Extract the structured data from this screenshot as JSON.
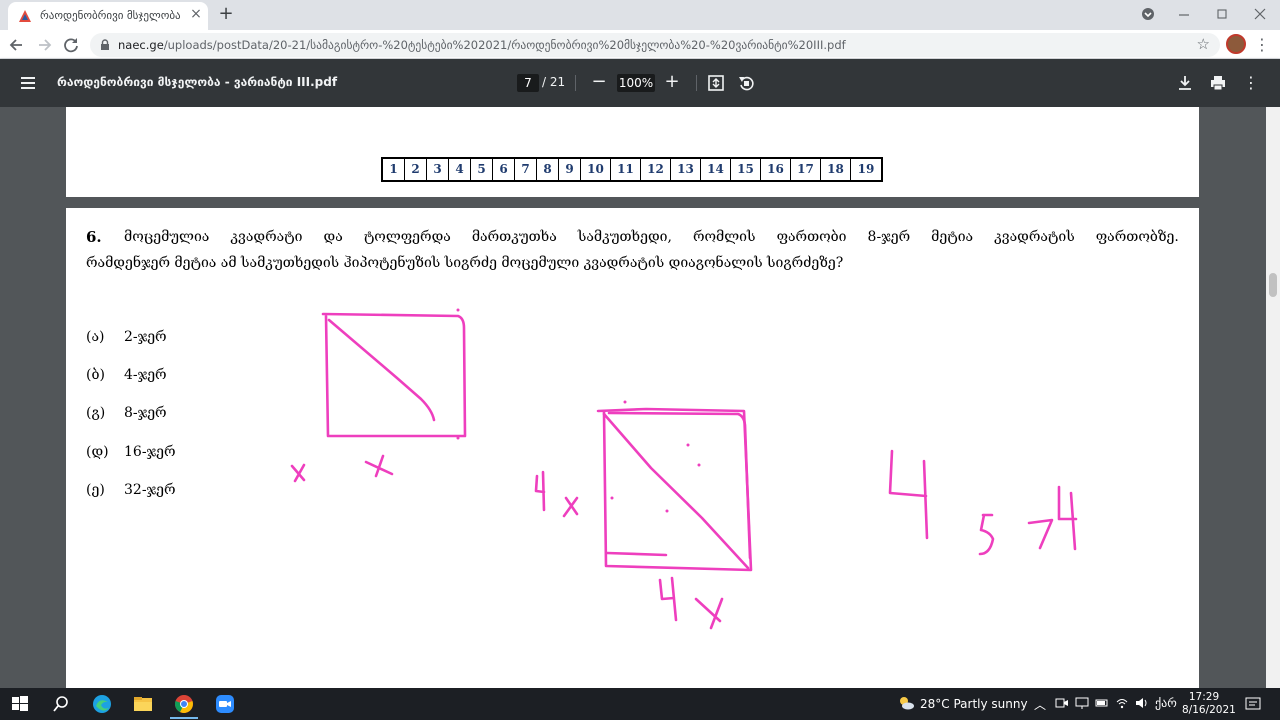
{
  "browser": {
    "tab_title": "რაოდენობრივი მსჯელობა - ",
    "tab_close": "×",
    "new_tab": "+",
    "url_host": "naec.ge",
    "url_path": "/uploads/postData/20-21/სამაგისტრო-%20ტესტები%202021/რაოდენობრივი%20მსჯელობა%20-%20ვარიანტი%20III.pdf",
    "icons": [
      "back-icon",
      "forward-icon",
      "reload-icon",
      "lock-icon",
      "star-icon",
      "kebab-menu-icon"
    ]
  },
  "pdf_toolbar": {
    "title": "რაოდენობრივი მსჯელობა - ვარიანტი III.pdf",
    "page_current": "7",
    "page_total": "/ 21",
    "zoom": "100%",
    "zoom_out": "−",
    "zoom_in": "+"
  },
  "page_nav": [
    "1",
    "2",
    "3",
    "4",
    "5",
    "6",
    "7",
    "8",
    "9",
    "10",
    "11",
    "12",
    "13",
    "14",
    "15",
    "16",
    "17",
    "18",
    "19"
  ],
  "question": {
    "number": "6.",
    "line1_words": [
      "მოცემულია",
      "კვადრატი",
      "და",
      "ტოლფერდა",
      "მართკუთხა",
      "სამკუთხედი,",
      "რომლის",
      "ფართობი",
      "8-ჯერ",
      "მეტია",
      "კვადრატის",
      "ფართობზე."
    ],
    "line2": "რამდენჯერ მეტია ამ სამკუთხედის ჰიპოტენუზის სიგრძე მოცემული კვადრატის დიაგონალის სიგრძეზე?",
    "options": [
      {
        "label": "(ა)",
        "text": "2-ჯერ"
      },
      {
        "label": "(ბ)",
        "text": "4-ჯერ"
      },
      {
        "label": "(გ)",
        "text": "8-ჯერ"
      },
      {
        "label": "(დ)",
        "text": "16-ჯერ"
      },
      {
        "label": "(ე)",
        "text": "32-ჯერ"
      }
    ]
  },
  "annotation_color": "#ee3fbe",
  "taskbar": {
    "weather": "28°C  Partly sunny",
    "lang": "ქარ",
    "time": "17:29",
    "date": "8/16/2021"
  }
}
